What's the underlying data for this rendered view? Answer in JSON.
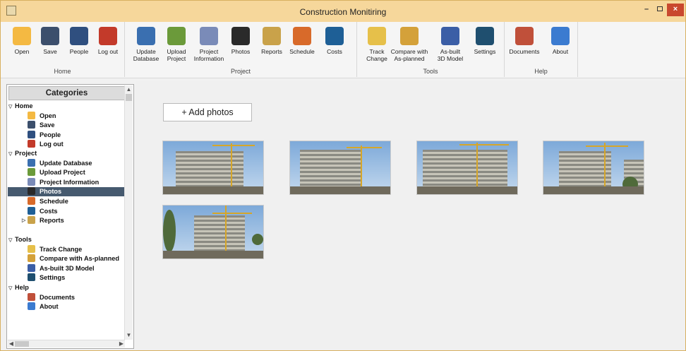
{
  "window": {
    "title": "Construction Monitiring"
  },
  "ribbon": {
    "groups": [
      {
        "label": "Home",
        "tools": [
          {
            "label": "Open",
            "icon": "open-folder-icon",
            "color": "#f4b942"
          },
          {
            "label": "Save",
            "icon": "save-icon",
            "color": "#3c4f6c"
          },
          {
            "label": "People",
            "icon": "people-icon",
            "color": "#2f4f7f"
          },
          {
            "label": "Log out",
            "icon": "logout-icon",
            "color": "#c33a2a"
          }
        ]
      },
      {
        "label": "Project",
        "tools": [
          {
            "label": "Update\nDatabase",
            "icon": "globe-icon",
            "color": "#3a6fb0"
          },
          {
            "label": "Upload\nProject",
            "icon": "upload-icon",
            "color": "#6b9a3a"
          },
          {
            "label": "Project\nInformation",
            "icon": "project-info-icon",
            "color": "#7a8bb8"
          },
          {
            "label": "Photos",
            "icon": "camera-icon",
            "color": "#2a2a2a"
          },
          {
            "label": "Reports",
            "icon": "report-icon",
            "color": "#c9a24a"
          },
          {
            "label": "Schedule",
            "icon": "schedule-icon",
            "color": "#d86a2a"
          },
          {
            "label": "Costs",
            "icon": "gear-icon",
            "color": "#1e5f96"
          }
        ]
      },
      {
        "label": "Tools",
        "tools": [
          {
            "label": "Track\nChange",
            "icon": "track-change-icon",
            "color": "#e6c04a"
          },
          {
            "label": "Compare with\nAs-planned",
            "icon": "compare-icon",
            "color": "#d4a13a"
          },
          {
            "label": "As-built\n3D Model",
            "icon": "dwg-icon",
            "color": "#3b5ea6"
          },
          {
            "label": "Settings",
            "icon": "settings-icon",
            "color": "#1f4f6f"
          }
        ]
      },
      {
        "label": "Help",
        "tools": [
          {
            "label": "Documents",
            "icon": "documents-icon",
            "color": "#c0503a"
          },
          {
            "label": "About",
            "icon": "about-icon",
            "color": "#3b7bd0"
          }
        ]
      }
    ]
  },
  "sidebar": {
    "title": "Categories",
    "sections": [
      {
        "label": "Home",
        "items": [
          {
            "label": "Open",
            "color": "#f4b942"
          },
          {
            "label": "Save",
            "color": "#3c4f6c"
          },
          {
            "label": "People",
            "color": "#2f4f7f"
          },
          {
            "label": "Log out",
            "color": "#c33a2a"
          }
        ]
      },
      {
        "label": "Project",
        "items": [
          {
            "label": "Update Database",
            "color": "#3a6fb0"
          },
          {
            "label": "Upload Project",
            "color": "#6b9a3a"
          },
          {
            "label": "Project Information",
            "color": "#7a8bb8"
          },
          {
            "label": "Photos",
            "color": "#2a2a2a",
            "selected": true
          },
          {
            "label": "Schedule",
            "color": "#d86a2a"
          },
          {
            "label": "Costs",
            "color": "#1e5f96"
          },
          {
            "label": "Reports",
            "color": "#c9a24a",
            "expandable": true
          }
        ]
      },
      {
        "label": "Tools",
        "items": [
          {
            "label": "Track Change",
            "color": "#e6c04a"
          },
          {
            "label": "Compare with As-planned",
            "color": "#d4a13a"
          },
          {
            "label": "As-built 3D Model",
            "color": "#3b5ea6"
          },
          {
            "label": "Settings",
            "color": "#1f4f6f"
          }
        ]
      },
      {
        "label": "Help",
        "items": [
          {
            "label": "Documents",
            "color": "#c0503a"
          },
          {
            "label": "About",
            "color": "#3b7bd0"
          }
        ]
      }
    ]
  },
  "main": {
    "add_button": "+ Add photos",
    "photo_count": 5
  },
  "colors": {
    "titlebar": "#f6d79b",
    "selection": "#465a6f",
    "close": "#c9482e"
  }
}
